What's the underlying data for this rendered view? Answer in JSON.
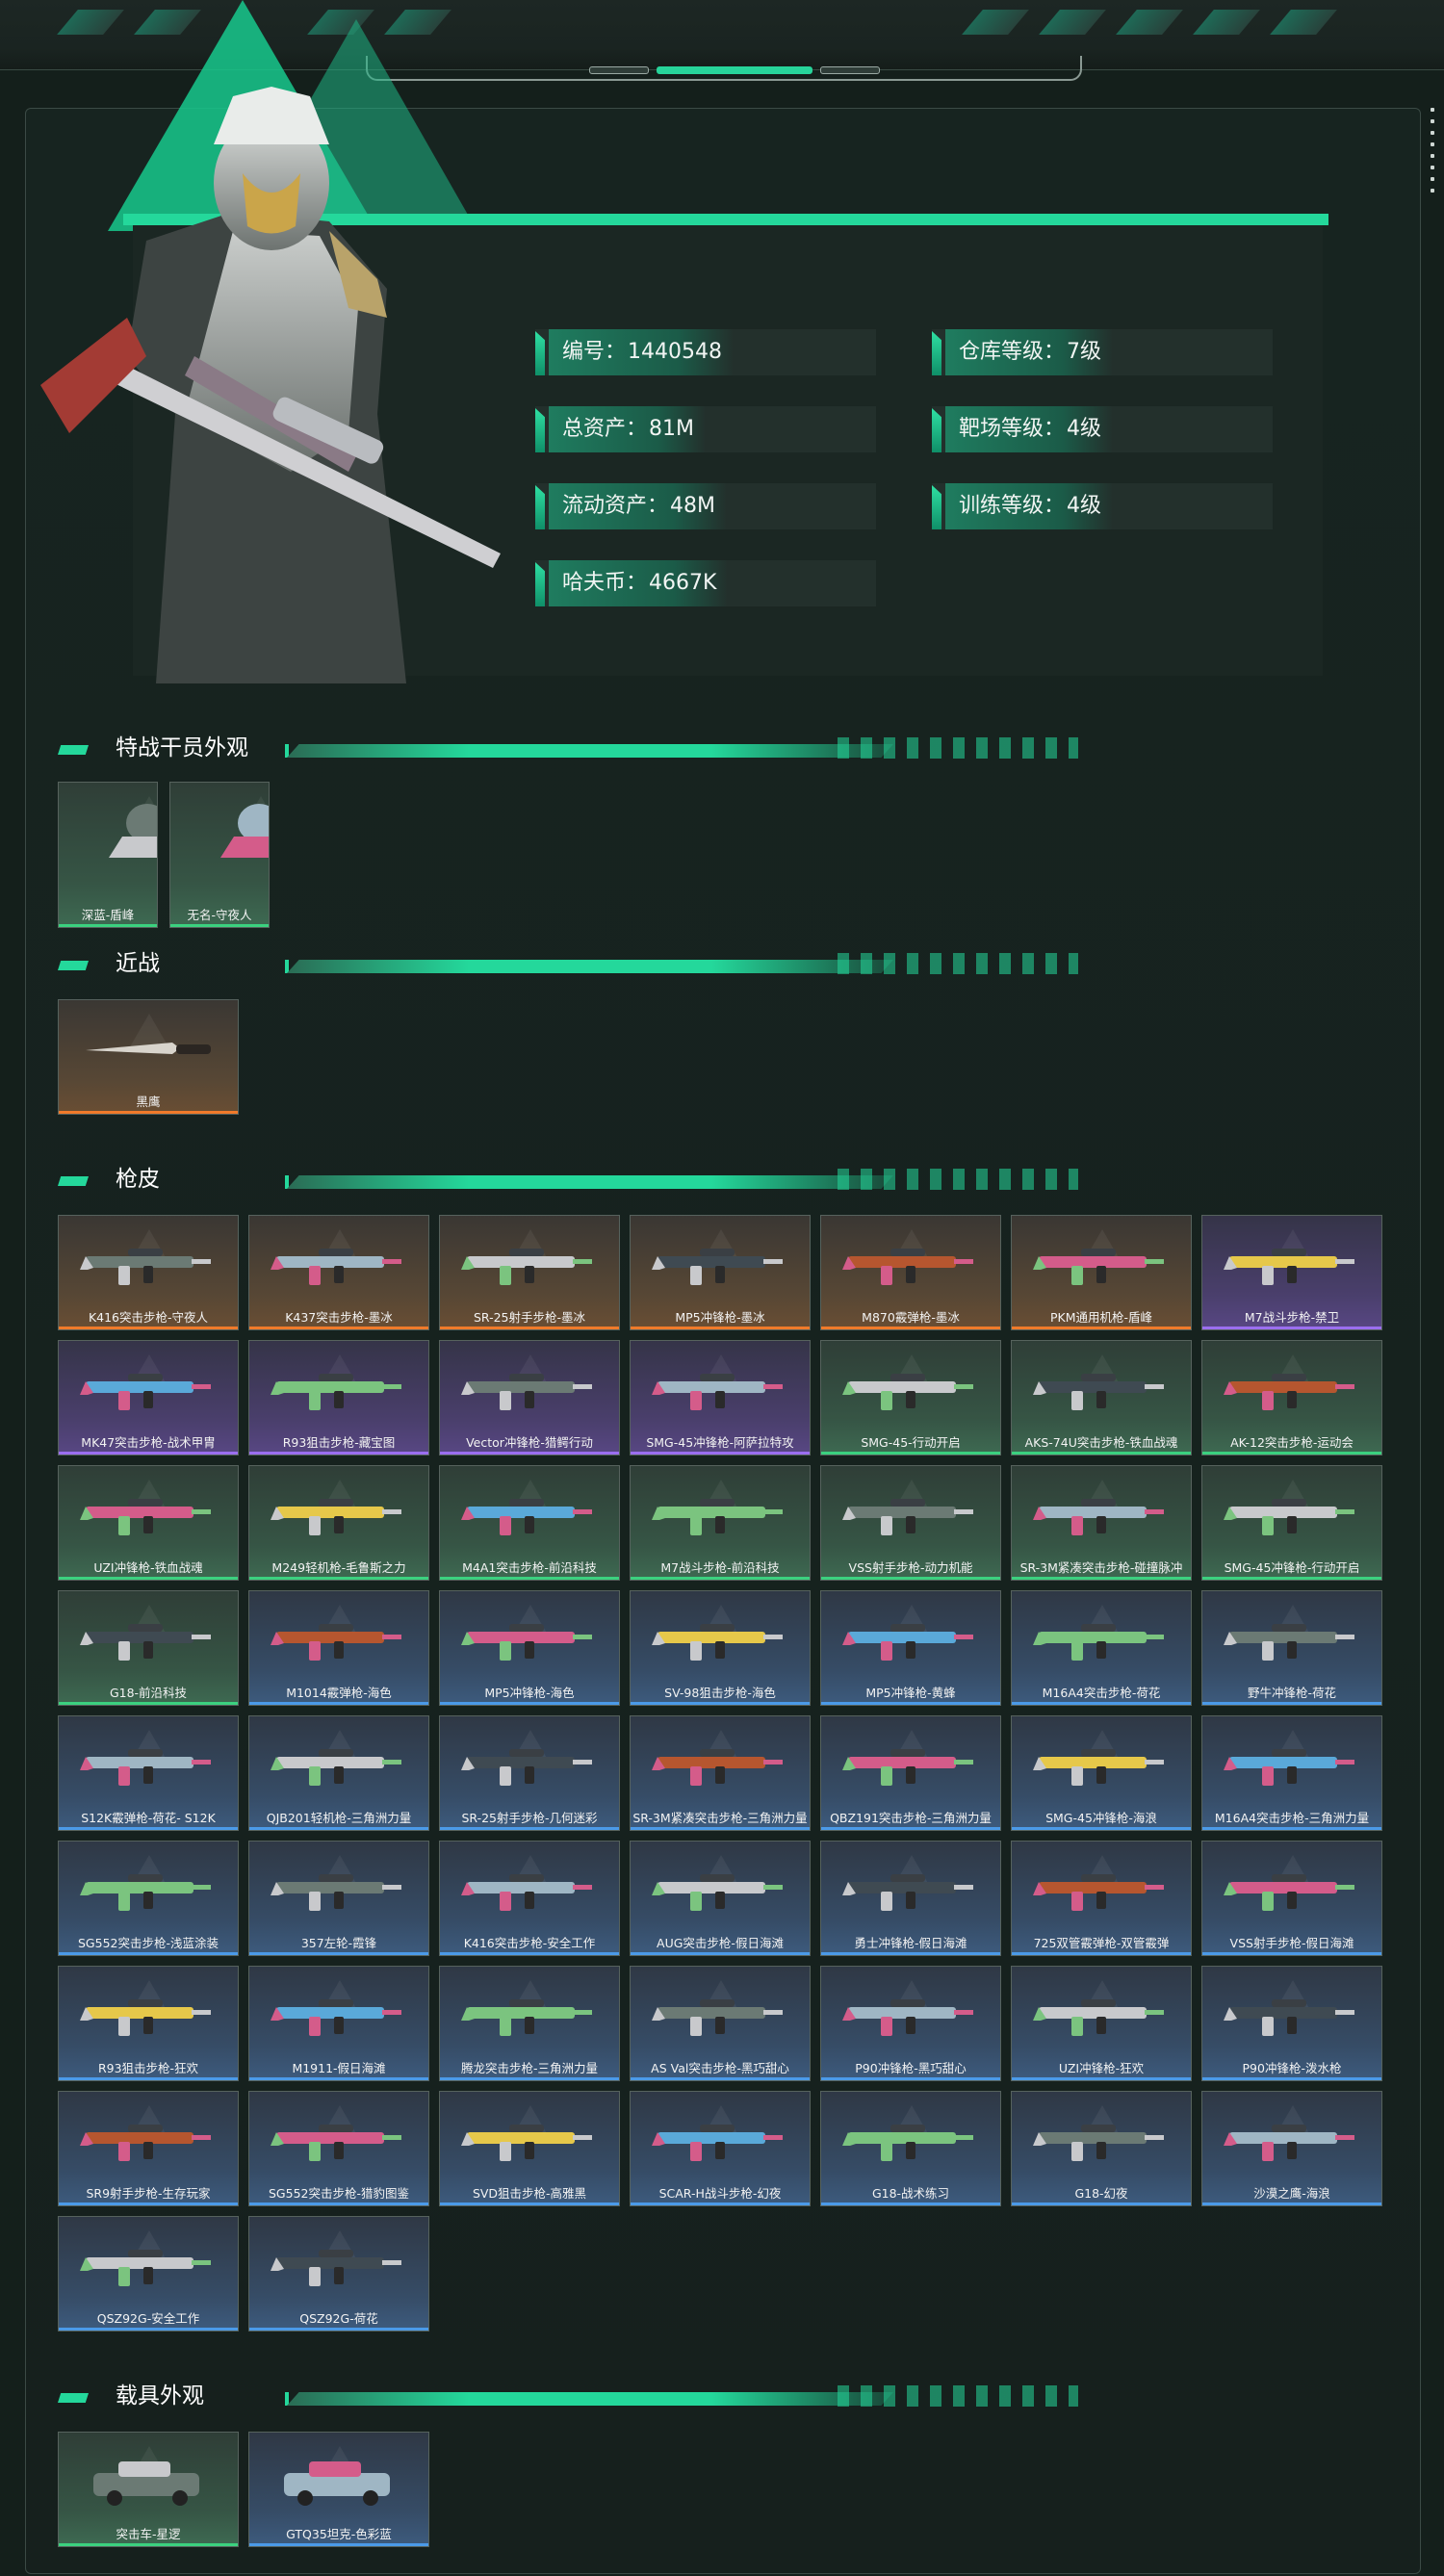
{
  "profile": {
    "stats": [
      {
        "label": "编号：",
        "value": "1440548"
      },
      {
        "label": "仓库等级：",
        "value": "7级"
      },
      {
        "label": "总资产：",
        "value": "81M"
      },
      {
        "label": "靶场等级：",
        "value": "4级"
      },
      {
        "label": "流动资产：",
        "value": "48M"
      },
      {
        "label": "训练等级：",
        "value": "4级"
      },
      {
        "label": "哈夫币：",
        "value": "4667K"
      }
    ]
  },
  "sections": {
    "agents": "特战干员外观",
    "melee": "近战",
    "skins": "枪皮",
    "vehicles": "载具外观"
  },
  "agents": [
    {
      "label": "深蓝-盾峰",
      "rarity": "green"
    },
    {
      "label": "无名-守夜人",
      "rarity": "green"
    }
  ],
  "melee": [
    {
      "label": "黑鹰",
      "rarity": "orange"
    }
  ],
  "skins": [
    {
      "label": "K416突击步枪-守夜人",
      "rarity": "orange"
    },
    {
      "label": "K437突击步枪-墨冰",
      "rarity": "orange"
    },
    {
      "label": "SR-25射手步枪-墨冰",
      "rarity": "orange"
    },
    {
      "label": "MP5冲锋枪-墨冰",
      "rarity": "orange"
    },
    {
      "label": "M870霰弹枪-墨冰",
      "rarity": "orange"
    },
    {
      "label": "PKM通用机枪-盾峰",
      "rarity": "orange"
    },
    {
      "label": "M7战斗步枪-禁卫",
      "rarity": "purple"
    },
    {
      "label": "MK47突击步枪-战术甲胄",
      "rarity": "purple"
    },
    {
      "label": "R93狙击步枪-藏宝图",
      "rarity": "purple"
    },
    {
      "label": "Vector冲锋枪-猎鳄行动",
      "rarity": "purple"
    },
    {
      "label": "SMG-45冲锋枪-阿萨拉特攻",
      "rarity": "purple"
    },
    {
      "label": "SMG-45-行动开启",
      "rarity": "green"
    },
    {
      "label": "AKS-74U突击步枪-铁血战魂",
      "rarity": "green"
    },
    {
      "label": "AK-12突击步枪-运动会",
      "rarity": "green"
    },
    {
      "label": "UZI冲锋枪-铁血战魂",
      "rarity": "green"
    },
    {
      "label": "M249轻机枪-毛鲁斯之力",
      "rarity": "green"
    },
    {
      "label": "M4A1突击步枪-前沿科技",
      "rarity": "green"
    },
    {
      "label": "M7战斗步枪-前沿科技",
      "rarity": "green"
    },
    {
      "label": "VSS射手步枪-动力机能",
      "rarity": "green"
    },
    {
      "label": "SR-3M紧凑突击步枪-碰撞脉冲",
      "rarity": "green"
    },
    {
      "label": "SMG-45冲锋枪-行动开启",
      "rarity": "green"
    },
    {
      "label": "G18-前沿科技",
      "rarity": "green"
    },
    {
      "label": "M1014霰弹枪-海色",
      "rarity": "blue"
    },
    {
      "label": "MP5冲锋枪-海色",
      "rarity": "blue"
    },
    {
      "label": "SV-98狙击步枪-海色",
      "rarity": "blue"
    },
    {
      "label": "MP5冲锋枪-黄蜂",
      "rarity": "blue"
    },
    {
      "label": "M16A4突击步枪-荷花",
      "rarity": "blue"
    },
    {
      "label": "野牛冲锋枪-荷花",
      "rarity": "blue"
    },
    {
      "label": "S12K霰弹枪-荷花- S12K",
      "rarity": "blue"
    },
    {
      "label": "QJB201轻机枪-三角洲力量",
      "rarity": "blue"
    },
    {
      "label": "SR-25射手步枪-几何迷彩",
      "rarity": "blue"
    },
    {
      "label": "SR-3M紧凑突击步枪-三角洲力量",
      "rarity": "blue"
    },
    {
      "label": "QBZ191突击步枪-三角洲力量",
      "rarity": "blue"
    },
    {
      "label": "SMG-45冲锋枪-海浪",
      "rarity": "blue"
    },
    {
      "label": "M16A4突击步枪-三角洲力量",
      "rarity": "blue"
    },
    {
      "label": "SG552突击步枪-浅蓝涂装",
      "rarity": "blue"
    },
    {
      "label": "357左轮-霞锋",
      "rarity": "blue"
    },
    {
      "label": "K416突击步枪-安全工作",
      "rarity": "blue"
    },
    {
      "label": "AUG突击步枪-假日海滩",
      "rarity": "blue"
    },
    {
      "label": "勇士冲锋枪-假日海滩",
      "rarity": "blue"
    },
    {
      "label": "725双管霰弹枪-双管霰弹",
      "rarity": "blue"
    },
    {
      "label": "VSS射手步枪-假日海滩",
      "rarity": "blue"
    },
    {
      "label": "R93狙击步枪-狂欢",
      "rarity": "blue"
    },
    {
      "label": "M1911-假日海滩",
      "rarity": "blue"
    },
    {
      "label": "腾龙突击步枪-三角洲力量",
      "rarity": "blue"
    },
    {
      "label": "AS Val突击步枪-黑巧甜心",
      "rarity": "blue"
    },
    {
      "label": "P90冲锋枪-黑巧甜心",
      "rarity": "blue"
    },
    {
      "label": "UZI冲锋枪-狂欢",
      "rarity": "blue"
    },
    {
      "label": "P90冲锋枪-泼水枪",
      "rarity": "blue"
    },
    {
      "label": "SR9射手步枪-生存玩家",
      "rarity": "blue"
    },
    {
      "label": "SG552突击步枪-猎豹图鉴",
      "rarity": "blue"
    },
    {
      "label": "SVD狙击步枪-高雅黑",
      "rarity": "blue"
    },
    {
      "label": "SCAR-H战斗步枪-幻夜",
      "rarity": "blue"
    },
    {
      "label": "G18-战术练习",
      "rarity": "blue"
    },
    {
      "label": "G18-幻夜",
      "rarity": "blue"
    },
    {
      "label": "沙漠之鹰-海浪",
      "rarity": "blue"
    },
    {
      "label": "QSZ92G-安全工作",
      "rarity": "blue"
    },
    {
      "label": "QSZ92G-荷花",
      "rarity": "blue"
    }
  ],
  "vehicles": [
    {
      "label": "突击车-星逻",
      "rarity": "green"
    },
    {
      "label": "GTQ35坦克-色彩蓝",
      "rarity": "blue"
    }
  ],
  "colors": {
    "accent": "#24d89b",
    "orange": "#f07a2a",
    "purple": "#9b6ef0",
    "green": "#3bd17f",
    "blue": "#4b9ae8"
  }
}
